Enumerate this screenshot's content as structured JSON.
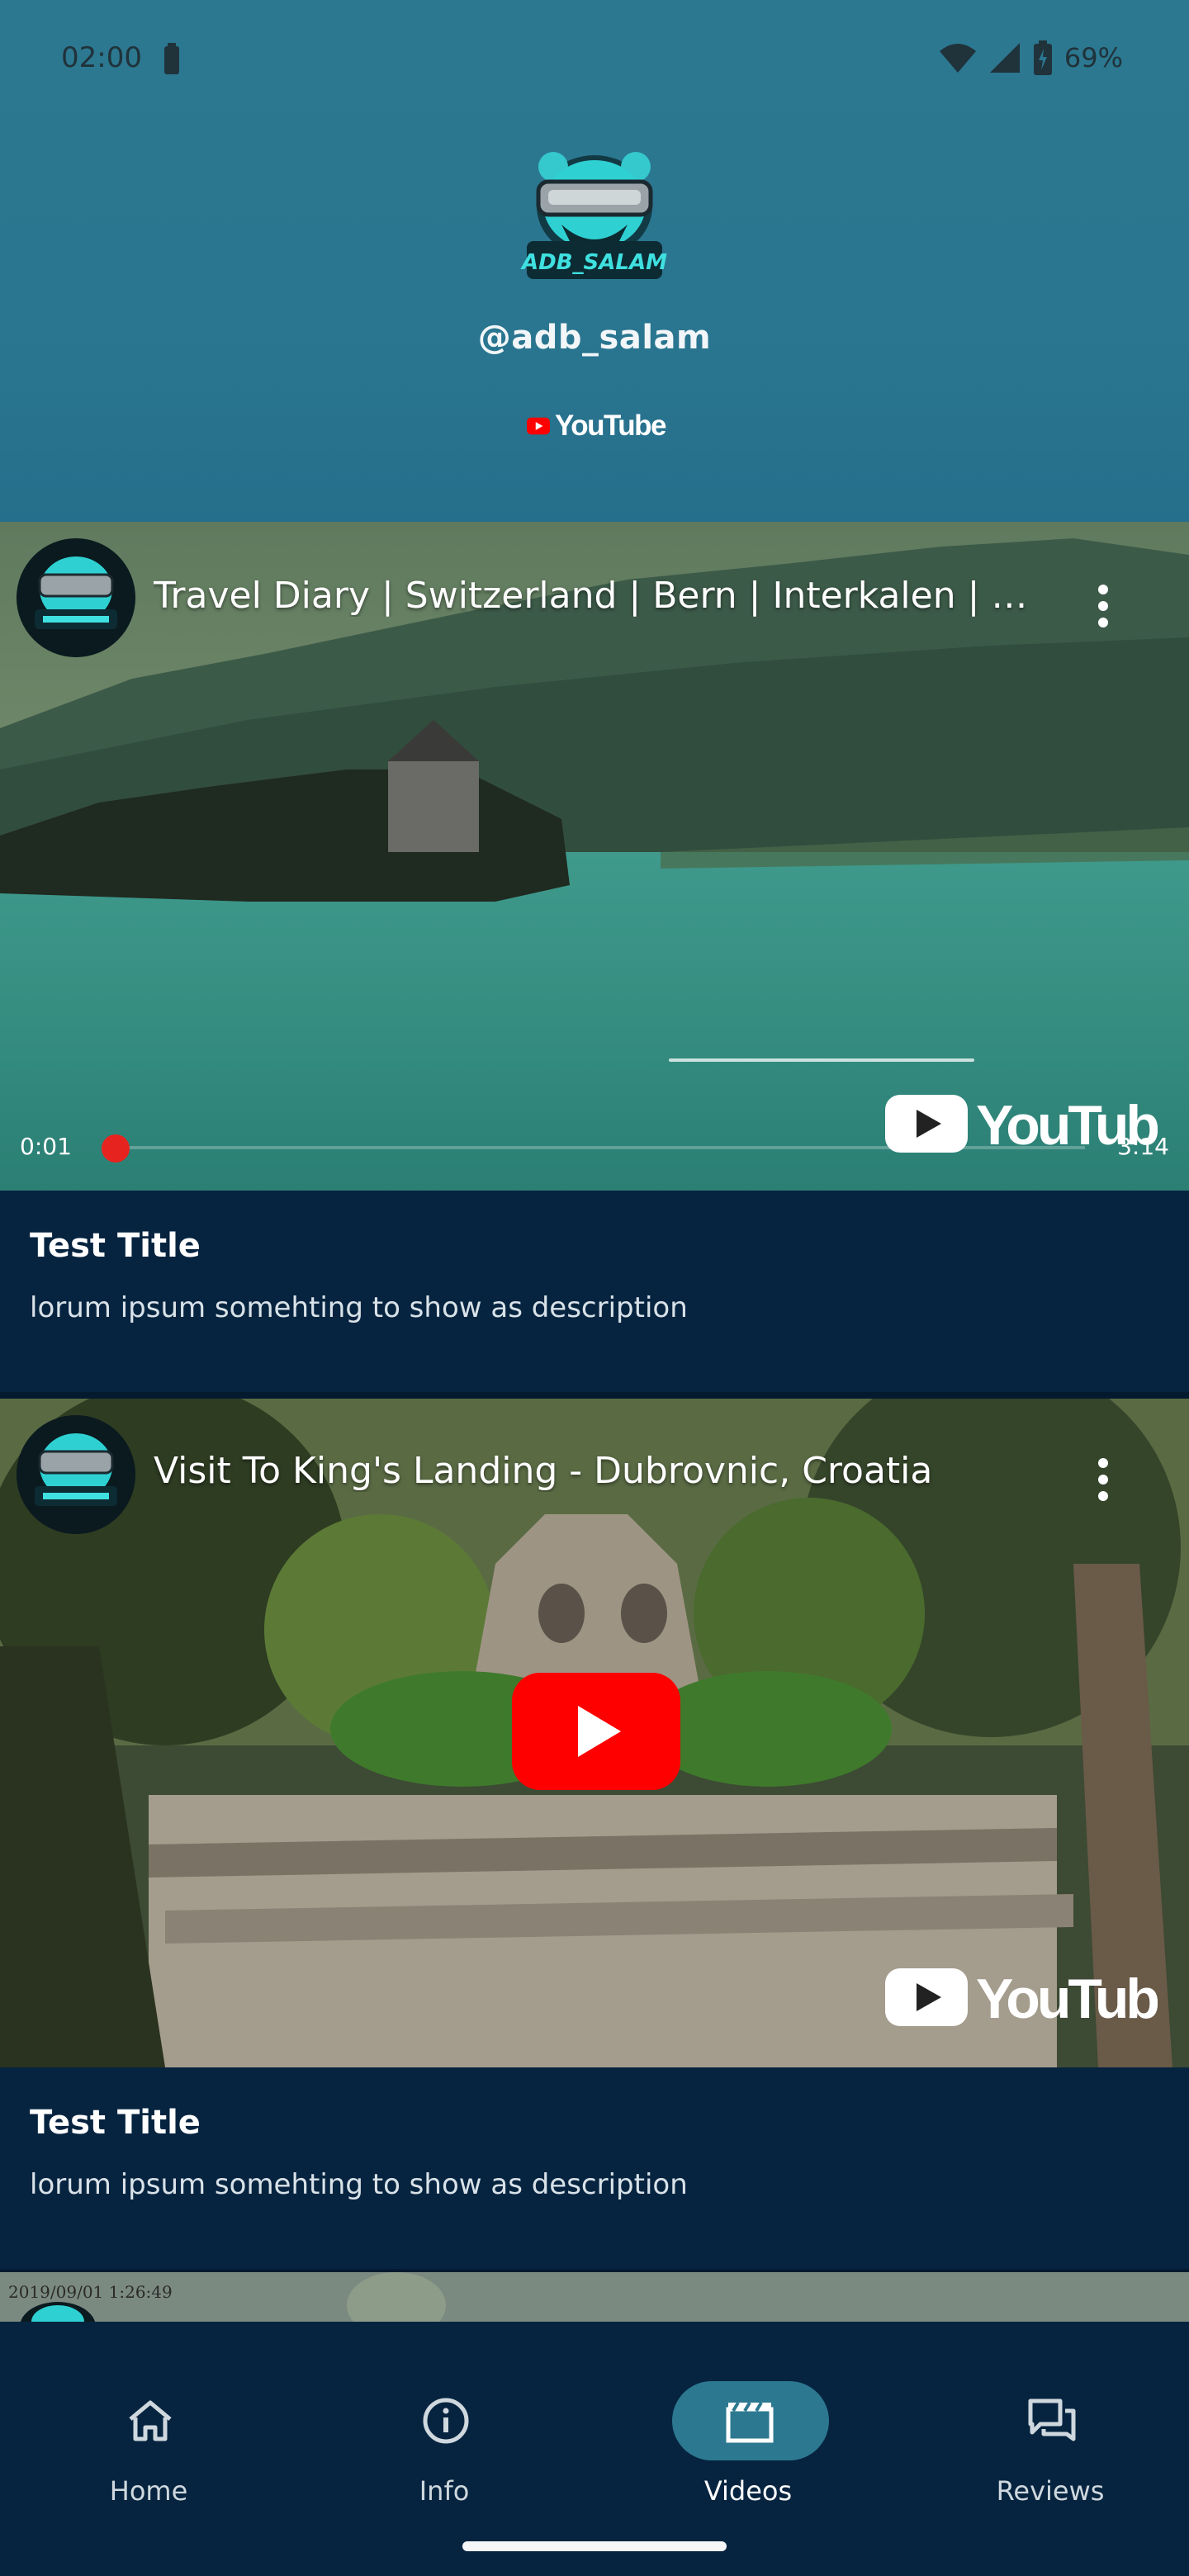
{
  "status_bar": {
    "time": "02:00",
    "battery_percent": "69%"
  },
  "profile": {
    "handle": "@adb_salam",
    "platform_label": "YouTube",
    "logo_text": "ADB_SALAM"
  },
  "videos": [
    {
      "title": "Travel Diary | Switzerland | Bern | Interkalen | Lake O…",
      "current_time": "0:01",
      "total_time": "3:14",
      "progress": 0.005,
      "watermark": "YouTube",
      "card_title": "Test Title",
      "card_description": "lorum ipsum somehting to show as description"
    },
    {
      "title": "Visit To King's Landing - Dubrovnic, Croatia",
      "watermark": "YouTube",
      "card_title": "Test Title",
      "card_description": "lorum ipsum somehting to show as description"
    },
    {
      "timestamp_overlay": "2019/09/01 1:26:49"
    }
  ],
  "bottom_nav": {
    "items": [
      {
        "label": "Home",
        "icon": "home-icon",
        "active": false
      },
      {
        "label": "Info",
        "icon": "info-icon",
        "active": false
      },
      {
        "label": "Videos",
        "icon": "clapperboard-icon",
        "active": true
      },
      {
        "label": "Reviews",
        "icon": "chat-bubbles-icon",
        "active": false
      }
    ]
  },
  "colors": {
    "header": "#2a7690",
    "background": "#062440",
    "accent": "#2c7890",
    "youtube_red": "#ff0000"
  }
}
